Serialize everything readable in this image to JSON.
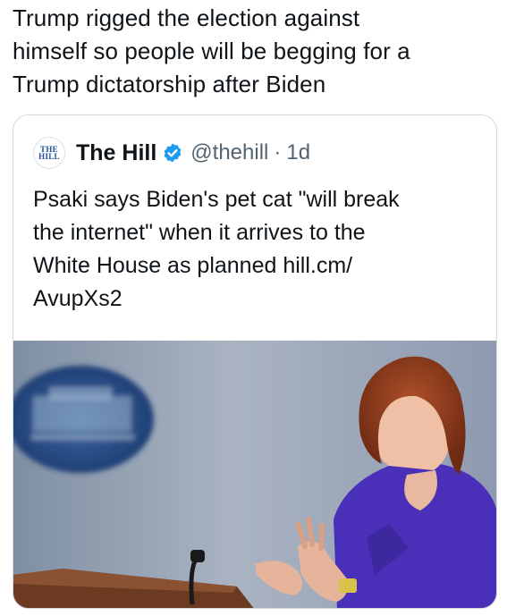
{
  "tweet": {
    "text_lines": [
      "Trump rigged the election against",
      "himself so people will be begging for a",
      "Trump dictatorship after Biden"
    ]
  },
  "quoted_tweet": {
    "avatar_text": [
      "THE",
      "HILL"
    ],
    "display_name": "The Hill",
    "verified_icon": "verified-badge-icon",
    "handle": "@thehill",
    "separator": "·",
    "timestamp": "1d",
    "text_lines": [
      "Psaki says Biden's pet cat \"will break",
      "the internet\" when it arrives to the",
      "White House as planned hill.cm/",
      "AvupXs2"
    ],
    "media": {
      "description_icon": "press-briefing-photo",
      "accent_color": "#4a2fb8"
    }
  },
  "colors": {
    "text": "#0f1419",
    "secondary": "#536471",
    "verified": "#1d9bf0",
    "border": "#cfd9de"
  }
}
